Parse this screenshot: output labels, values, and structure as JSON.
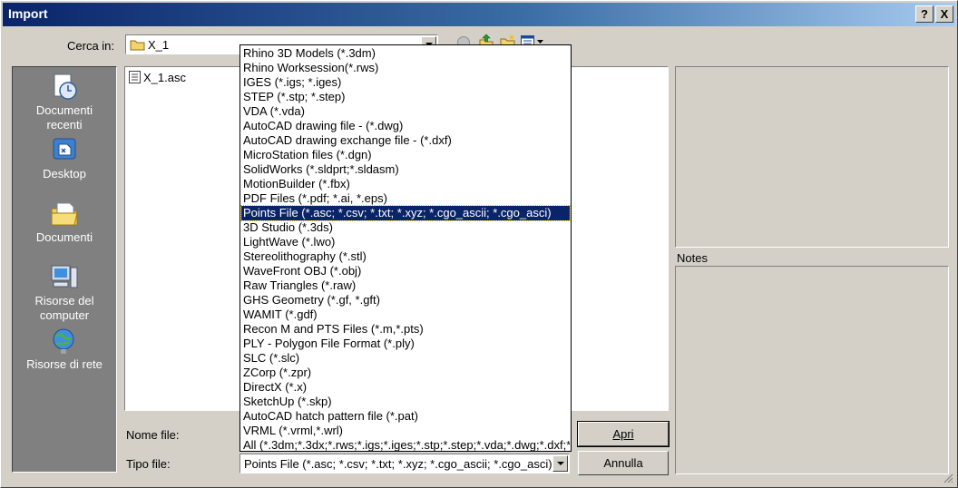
{
  "window": {
    "title": "Import",
    "help_label": "?",
    "close_label": "X"
  },
  "lookin": {
    "label": "Cerca in:",
    "value": "X_1"
  },
  "places": [
    {
      "label_line1": "Documenti",
      "label_line2": "recenti",
      "icon": "recent-documents-icon"
    },
    {
      "label_line1": "Desktop",
      "label_line2": "",
      "icon": "desktop-icon"
    },
    {
      "label_line1": "Documenti",
      "label_line2": "",
      "icon": "documents-folder-icon"
    },
    {
      "label_line1": "Risorse del",
      "label_line2": "computer",
      "icon": "my-computer-icon"
    },
    {
      "label_line1": "Risorse di rete",
      "label_line2": "",
      "icon": "network-icon"
    }
  ],
  "files": [
    {
      "name": "X_1.asc",
      "icon": "text-file-icon"
    }
  ],
  "filename": {
    "label": "Nome file:",
    "value": ""
  },
  "filetype": {
    "label": "Tipo file:",
    "value": "Points File (*.asc; *.csv; *.txt; *.xyz; *.cgo_ascii; *.cgo_asci)",
    "options": [
      "Rhino 3D Models (*.3dm)",
      "Rhino Worksession(*.rws)",
      "IGES (*.igs; *.iges)",
      "STEP (*.stp; *.step)",
      "VDA (*.vda)",
      "AutoCAD drawing file - (*.dwg)",
      "AutoCAD drawing exchange file - (*.dxf)",
      "MicroStation files (*.dgn)",
      "SolidWorks (*.sldprt;*.sldasm)",
      "MotionBuilder (*.fbx)",
      "PDF Files (*.pdf; *.ai, *.eps)",
      "Points File (*.asc; *.csv; *.txt; *.xyz; *.cgo_ascii; *.cgo_asci)",
      "3D Studio (*.3ds)",
      "LightWave (*.lwo)",
      "Stereolithography (*.stl)",
      "WaveFront OBJ (*.obj)",
      "Raw Triangles (*.raw)",
      "GHS Geometry (*.gf, *.gft)",
      "WAMIT (*.gdf)",
      "Recon M and PTS Files (*.m,*.pts)",
      "PLY - Polygon File Format (*.ply)",
      "SLC (*.slc)",
      "ZCorp (*.zpr)",
      "DirectX (*.x)",
      "SketchUp (*.skp)",
      "AutoCAD hatch pattern file (*.pat)",
      "VRML (*.vrml,*.wrl)",
      "All (*.3dm;*.3dx;*.rws;*.igs;*.iges;*.stp;*.step;*.vda;*.dwg;*.dxf;*"
    ],
    "selected_index": 11
  },
  "buttons": {
    "open": "Apri",
    "cancel": "Annulla"
  },
  "notes_label": "Notes",
  "colors": {
    "title_start": "#0a246a",
    "title_end": "#a6caf0",
    "selection": "#0a246a",
    "face": "#d4d0c8"
  }
}
